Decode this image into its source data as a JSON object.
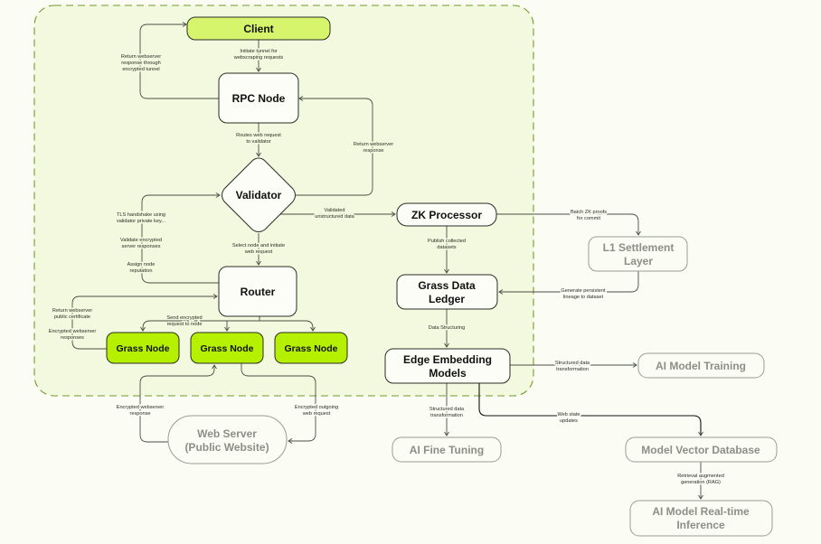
{
  "nodes": {
    "client": "Client",
    "rpc": "RPC Node",
    "validator": "Validator",
    "zk": "ZK Processor",
    "l1": [
      "L1 Settlement",
      "Layer"
    ],
    "ledger": [
      "Grass Data",
      "Ledger"
    ],
    "router": "Router",
    "grass_nodes": [
      "Grass Node",
      "Grass Node",
      "Grass Node"
    ],
    "edge_models": [
      "Edge Embedding",
      "Models"
    ],
    "ai_training": "AI Model Training",
    "web_server": [
      "Web Server",
      "(Public Website)"
    ],
    "ai_fine_tuning": "AI Fine Tuning",
    "vector_db": "Model Vector Database",
    "inference": [
      "AI Model Real-time",
      "Inference"
    ]
  },
  "edge_labels": {
    "client_to_rpc": [
      "Initiate tunnel for",
      "webscraping requests"
    ],
    "rpc_to_client": [
      "Return webserver",
      "response through",
      "encrypted tunnel"
    ],
    "rpc_to_validator": [
      "Routes web request",
      "to validator"
    ],
    "validator_to_rpc": [
      "Return webserver",
      "response"
    ],
    "validator_to_zk": [
      "Validated",
      "unstructured data"
    ],
    "tls": [
      "TLS handshake using",
      "validator private key..."
    ],
    "validate": [
      "Validate encrypted",
      "server responses"
    ],
    "reputation": [
      "Assign node",
      "reputation"
    ],
    "validator_to_router": [
      "Select node and initiate",
      "web request"
    ],
    "cert": [
      "Return webserver",
      "public certificate"
    ],
    "enc_responses": [
      "Encrypted webserver",
      "responses"
    ],
    "router_to_nodes": [
      "Send encrypted",
      "request to node"
    ],
    "web_response": [
      "Encrypted webserver",
      "response"
    ],
    "web_request": [
      "Encrypted outgoing",
      "web request"
    ],
    "zk_to_ledger": [
      "Publish collected",
      "datasets"
    ],
    "zk_to_l1": [
      "Batch ZK proofs",
      "for commit"
    ],
    "l1_to_ledger": [
      "Generate persistent",
      "lineage to dataset"
    ],
    "ledger_to_edge": [
      "Data Structuring"
    ],
    "edge_to_training": [
      "Structured data",
      "transformation"
    ],
    "edge_to_finetune": [
      "Structured data",
      "transformation"
    ],
    "edge_to_vector": [
      "Web state",
      "updates"
    ],
    "vector_to_inference": [
      "Retrieval augmented",
      "generation (RAG)"
    ]
  },
  "colors": {
    "background": "#fbfdf4",
    "boundary_fill": "#f3f9df",
    "boundary_stroke": "#6f9a2c",
    "grass_node": "#b4f000",
    "client": "#d6f56c",
    "external_gray": "#8c8f86"
  }
}
